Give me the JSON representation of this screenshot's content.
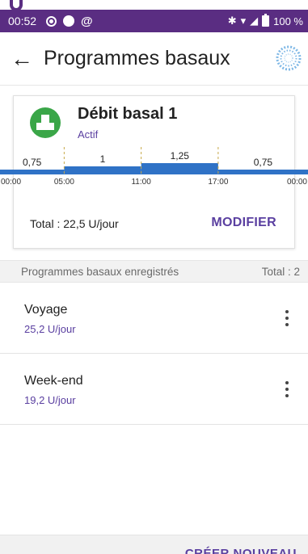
{
  "status_bar": {
    "time": "00:52",
    "battery": "100 %",
    "icons": [
      "alarm-clock-icon",
      "dot-icon",
      "at-sign-icon",
      "bluetooth-icon",
      "wifi-icon",
      "signal-icon",
      "battery-icon"
    ]
  },
  "header": {
    "title": "Programmes basaux",
    "back_icon": "arrow-left-icon",
    "pod_icon": "pod-status-icon"
  },
  "active_program": {
    "name": "Débit basal 1",
    "status": "Actif",
    "icon": "basal-program-icon",
    "total": "Total : 22,5 U/jour",
    "modify_label": "MODIFIER",
    "accent_color": "#5a3fa0",
    "icon_color": "#3aa648",
    "bar_color": "#2f72c6"
  },
  "chart_data": {
    "type": "area",
    "segments": [
      {
        "start": "00:00",
        "end": "05:00",
        "rate": "0,75"
      },
      {
        "start": "05:00",
        "end": "11:00",
        "rate": "1"
      },
      {
        "start": "11:00",
        "end": "17:00",
        "rate": "1,25"
      },
      {
        "start": "17:00",
        "end": "00:00",
        "rate": "0,75"
      }
    ],
    "x_tick_labels": [
      "00:00",
      "05:00",
      "11:00",
      "17:00",
      "00:00"
    ],
    "x": [
      0,
      5,
      11,
      17,
      24
    ],
    "y": [
      0.75,
      1,
      1.25,
      0.75
    ]
  },
  "saved": {
    "header_label": "Programmes basaux enregistrés",
    "total_label": "Total : 2",
    "items": [
      {
        "name": "Voyage",
        "rate": "25,2 U/jour"
      },
      {
        "name": "Week-end",
        "rate": "19,2 U/jour"
      }
    ]
  },
  "footer": {
    "create_label": "CRÉER NOUVEAU"
  }
}
